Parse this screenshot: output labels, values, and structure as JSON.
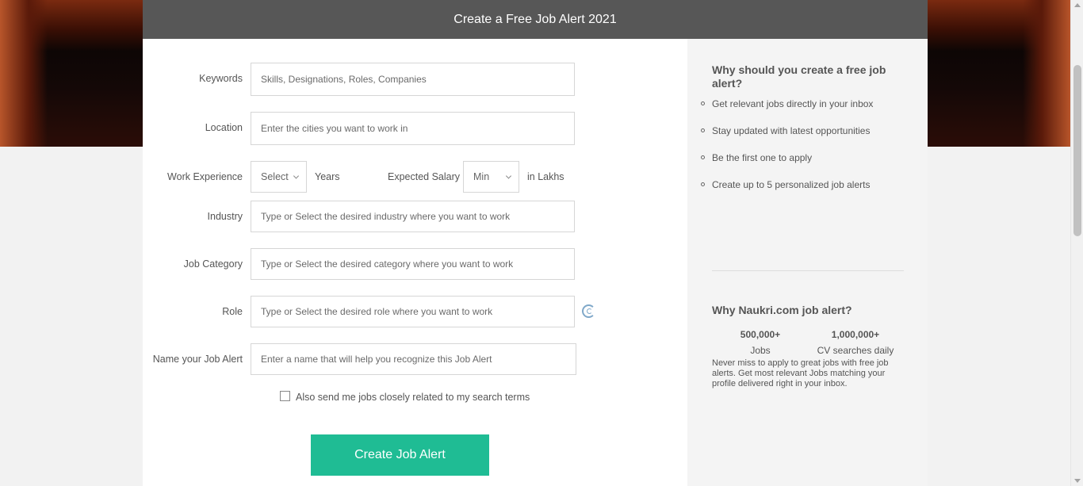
{
  "header": {
    "title": "Create a Free Job Alert 2021"
  },
  "form": {
    "keywords": {
      "label": "Keywords",
      "placeholder": "Skills, Designations, Roles, Companies"
    },
    "location": {
      "label": "Location",
      "placeholder": "Enter the cities you want to work in"
    },
    "experience": {
      "label": "Work Experience",
      "selected": "Select",
      "unit": "Years"
    },
    "salary": {
      "label": "Expected Salary",
      "selected": "Min",
      "unit": "in Lakhs"
    },
    "industry": {
      "label": "Industry",
      "placeholder": "Type or Select the desired industry where you want to work"
    },
    "job_category": {
      "label": "Job Category",
      "placeholder": "Type or Select the desired category where you want to work"
    },
    "role": {
      "label": "Role",
      "placeholder": "Type or Select the desired role where you want to work"
    },
    "alert_name": {
      "label": "Name your Job Alert",
      "placeholder": "Enter a name that will help you recognize this Job Alert"
    },
    "related_checkbox": {
      "label": "Also send me jobs closely related to my search terms",
      "checked": false
    },
    "submit_label": "Create Job Alert"
  },
  "sidebar": {
    "why_title": "Why should you create a free job alert?",
    "benefits": [
      "Get relevant jobs directly in your inbox",
      "Stay updated with latest opportunities",
      "Be the first one to apply",
      "Create up to 5 personalized job alerts"
    ],
    "naukri_title": "Why Naukri.com job alert?",
    "stats": [
      {
        "value": "500,000+",
        "label": "Jobs"
      },
      {
        "value": "1,000,000+",
        "label": "CV searches daily"
      }
    ],
    "description": "Never miss to apply to great jobs with free job alerts. Get most relevant Jobs matching your profile delivered right in your inbox."
  },
  "colors": {
    "header_bg": "#575757",
    "cta_bg": "#1fbc94",
    "sidebar_bg": "#f4f4f4"
  }
}
